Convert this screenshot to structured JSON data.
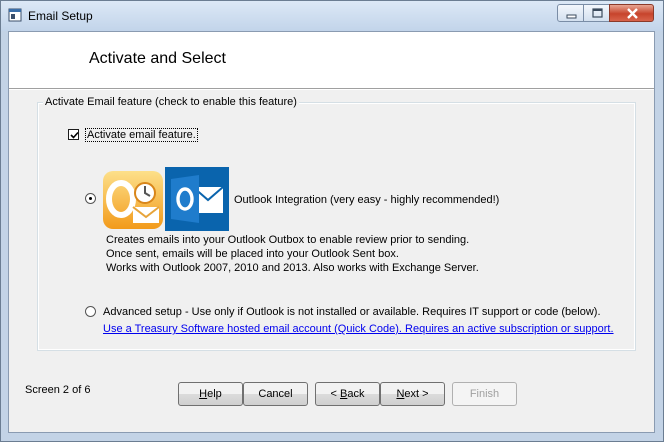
{
  "window": {
    "title": "Email Setup",
    "icon": "app-window-icon"
  },
  "header": {
    "title": "Activate and Select"
  },
  "group": {
    "label": "Activate Email feature (check to enable this feature)",
    "activate_checkbox": {
      "label": "Activate email feature.",
      "checked": true
    },
    "outlook_option": {
      "selected": true,
      "label": "Outlook Integration (very easy - highly recommended!)",
      "description": [
        "Creates emails into your Outlook Outbox to enable review prior to sending.",
        "Once sent, emails will be placed into your Outlook Sent box.",
        "Works with Outlook 2007, 2010 and 2013.  Also works with Exchange Server."
      ],
      "icons": [
        "outlook-2007-logo-icon",
        "outlook-2013-logo-icon"
      ]
    },
    "advanced_option": {
      "selected": false,
      "label": "Advanced setup - Use only if Outlook is not installed or available.  Requires IT support or code (below).",
      "link": "Use a Treasury Software hosted email account (Quick Code).  Requires an active subscription or support."
    }
  },
  "footer": {
    "status": "Screen 2 of 6",
    "buttons": {
      "help": {
        "pre": "",
        "hot": "H",
        "post": "elp"
      },
      "cancel": {
        "pre": "Cancel",
        "hot": "",
        "post": ""
      },
      "back": {
        "pre": "< ",
        "hot": "B",
        "post": "ack"
      },
      "next": {
        "pre": "",
        "hot": "N",
        "post": "ext >"
      },
      "finish": {
        "pre": "Finish",
        "hot": "",
        "post": "",
        "disabled": true
      }
    }
  },
  "colors": {
    "outlook_orange": "#f5a623",
    "outlook_blue": "#0a64ad",
    "link": "#0000ee"
  }
}
